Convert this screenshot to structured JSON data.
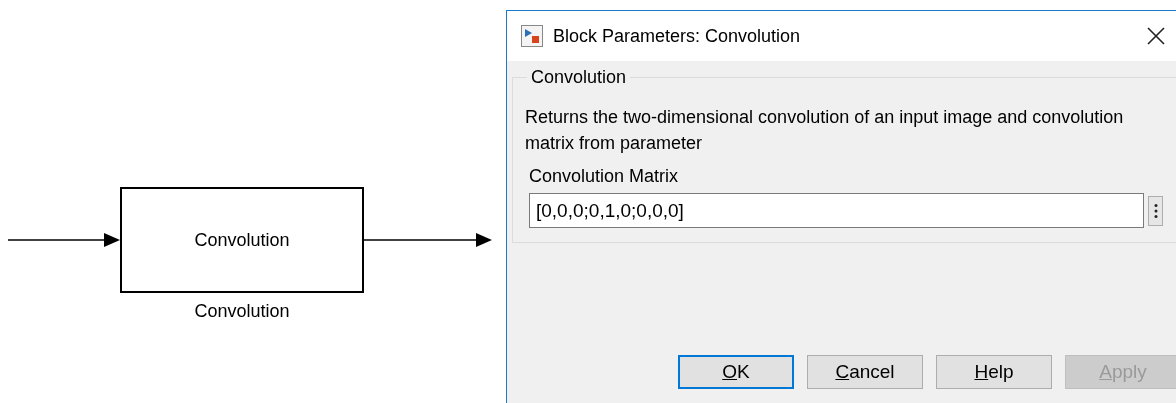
{
  "diagram": {
    "blocks": [
      {
        "name": "Convolution",
        "label": "Convolution"
      }
    ]
  },
  "dialog": {
    "title": "Block Parameters: Convolution",
    "group": {
      "title": "Convolution",
      "description": "Returns the two-dimensional convolution of an input image and convolution matrix from parameter",
      "parameters": [
        {
          "label": "Convolution Matrix",
          "value": "[0,0,0;0,1,0;0,0,0]"
        }
      ]
    },
    "buttons": [
      {
        "accel": "O",
        "rest": "K",
        "default": true,
        "disabled": false
      },
      {
        "accel": "C",
        "rest": "ancel",
        "default": false,
        "disabled": false
      },
      {
        "accel": "H",
        "rest": "elp",
        "default": false,
        "disabled": false
      },
      {
        "accel": "A",
        "rest": "pply",
        "default": false,
        "disabled": true
      }
    ]
  }
}
